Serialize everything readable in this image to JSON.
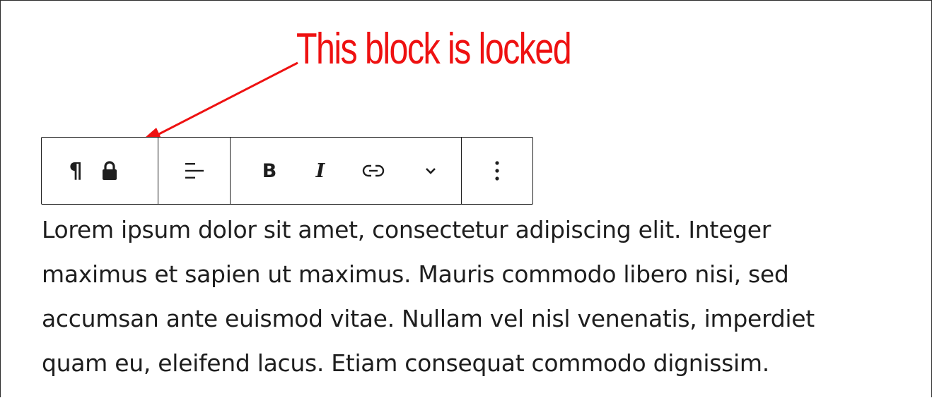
{
  "annotation": {
    "label": "This block is locked",
    "color": "#ee1111"
  },
  "toolbar": {
    "groups": [
      {
        "items": [
          {
            "icon": "paragraph-icon",
            "glyph": "¶"
          },
          {
            "icon": "lock-icon"
          }
        ]
      },
      {
        "items": [
          {
            "icon": "align-left-icon"
          }
        ]
      },
      {
        "items": [
          {
            "icon": "bold-icon",
            "glyph": "B"
          },
          {
            "icon": "italic-icon",
            "glyph": "I"
          },
          {
            "icon": "link-icon"
          },
          {
            "icon": "chevron-down-icon"
          }
        ]
      },
      {
        "items": [
          {
            "icon": "more-options-icon"
          }
        ]
      }
    ],
    "paragraph_glyph": "¶",
    "bold_glyph": "B",
    "italic_glyph": "I"
  },
  "paragraph": {
    "lines": [
      "Lorem ipsum dolor sit amet, consectetur adipiscing elit. Integer",
      "maximus et sapien ut maximus. Mauris commodo libero nisi, sed",
      "accumsan ante euismod vitae. Nullam vel nisl venenatis, imperdiet",
      "quam eu, eleifend lacus. Etiam consequat commodo dignissim."
    ]
  }
}
